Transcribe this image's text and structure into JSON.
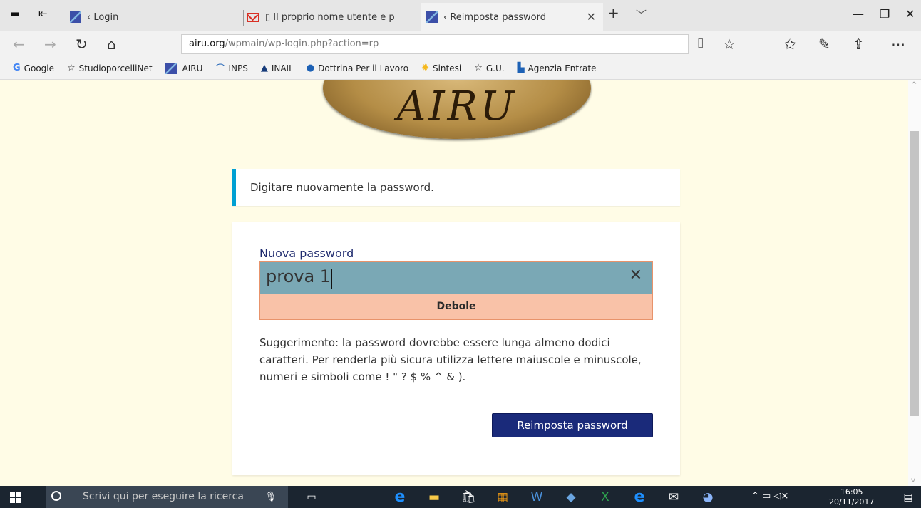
{
  "browser": {
    "tabs": [
      {
        "label": "‹ Login",
        "icon": "airu-favicon"
      },
      {
        "label": "▯ Il proprio nome utente e p",
        "icon": "gmail-favicon"
      },
      {
        "label": "‹ Reimposta password",
        "icon": "airu-favicon",
        "active": true
      }
    ],
    "address": {
      "host": "airu.org",
      "path": "/wpmain/wp-login.php?action=rp"
    },
    "favorites": [
      {
        "label": "Google",
        "icon": "google-icon"
      },
      {
        "label": "StudioporcelliNet",
        "icon": "star-icon"
      },
      {
        "label": "AIRU",
        "icon": "airu-favicon"
      },
      {
        "label": "INPS",
        "icon": "inps-icon"
      },
      {
        "label": "INAIL",
        "icon": "inail-icon"
      },
      {
        "label": "Dottrina Per il Lavoro",
        "icon": "pin-icon"
      },
      {
        "label": "Sintesi",
        "icon": "sun-icon"
      },
      {
        "label": "G.U.",
        "icon": "star-icon"
      },
      {
        "label": "Agenzia Entrate",
        "icon": "agenzia-icon"
      }
    ]
  },
  "page": {
    "logo_text": "AIRU",
    "notice": "Digitare nuovamente la password.",
    "form": {
      "label": "Nuova password",
      "value": "prova 1",
      "strength": "Debole",
      "hint": "Suggerimento: la password dovrebbe essere lunga almeno dodici caratteri. Per renderla più sicura utilizza lettere maiuscole e minuscole, numeri e simboli come ! \" ? $ % ^ & ).",
      "submit_label": "Reimposta password"
    }
  },
  "taskbar": {
    "search_placeholder": "Scrivi qui per eseguire la ricerca",
    "time": "16:05",
    "date": "20/11/2017"
  },
  "colors": {
    "page_bg": "#fffce6",
    "notice_accent": "#00a0d2",
    "button": "#1a2a7a",
    "strength_weak": "#f9c2a8"
  }
}
